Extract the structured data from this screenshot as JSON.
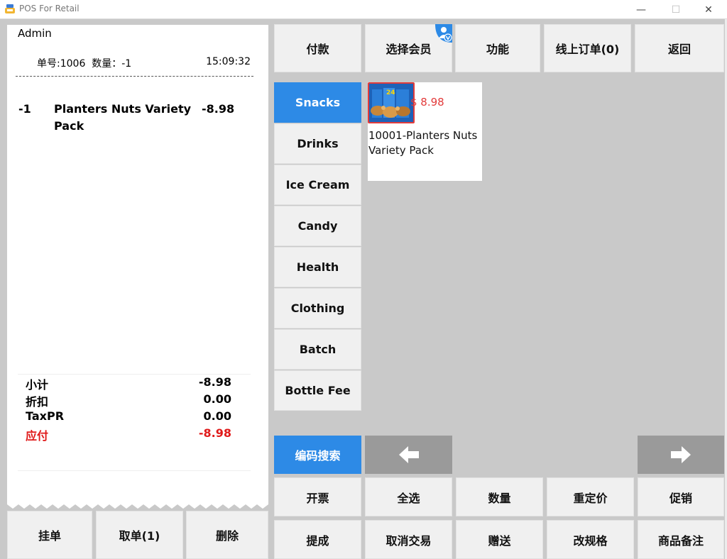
{
  "window": {
    "title": "POS For Retail",
    "minimize": "—",
    "maximize": "☐",
    "close": "✕"
  },
  "receipt": {
    "operator": "Admin",
    "order_info": "单号:1006  数量：-1",
    "time": "15:09:32",
    "items": [
      {
        "qty": "-1",
        "name": "Planters Nuts Variety Pack",
        "price": "-8.98"
      }
    ],
    "summary": [
      {
        "label": "小计",
        "value": "-8.98"
      },
      {
        "label": "折扣",
        "value": "0.00"
      },
      {
        "label": "TaxPR",
        "value": "0.00"
      },
      {
        "label": "应付",
        "value": "-8.98"
      }
    ]
  },
  "bottom_left": {
    "hold": "挂单",
    "retrieve": "取单(1)",
    "delete": "删除"
  },
  "top_bar": {
    "pay": "付款",
    "member": "选择会员",
    "function": "功能",
    "online_orders": "线上订单(0)",
    "back": "返回"
  },
  "categories": [
    "Snacks",
    "Drinks",
    "Ice Cream",
    "Candy",
    "Health",
    "Clothing",
    "Batch",
    "Bottle Fee"
  ],
  "selected_category": "Snacks",
  "product": {
    "price": "$ 8.98",
    "name": "10001-Planters Nuts Variety Pack",
    "thumb_text": "24"
  },
  "nav": {
    "code_search": "编码搜索",
    "prev": "prev-arrow",
    "next": "next-arrow"
  },
  "actions_row1": [
    "开票",
    "全选",
    "数量",
    "重定价",
    "促销"
  ],
  "actions_row2": [
    "提成",
    "取消交易",
    "赠送",
    "改规格",
    "商品备注"
  ],
  "colors": {
    "accent": "#2d8ae6",
    "due": "#e01a1a",
    "price": "#e23b3b",
    "panel_bg": "#c9c9c9"
  }
}
